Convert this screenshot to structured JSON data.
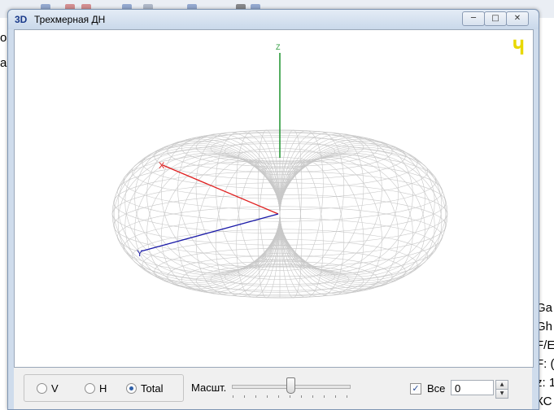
{
  "background_app": {
    "left_glyphs": [
      "о",
      "а"
    ],
    "right_labels": [
      "Ga",
      "Gh",
      "F/E",
      "F: (",
      "z: 1",
      "КС"
    ]
  },
  "window": {
    "icon_text": "3D",
    "title": "Трехмерная ДН",
    "minimize_icon": "minimize-icon",
    "maximize_icon": "maximize-icon",
    "close_icon": "close-icon"
  },
  "viewport": {
    "corner_mark": "Ч",
    "axes": {
      "x_label": "X",
      "y_label": "Y",
      "z_label": "Z"
    },
    "colors": {
      "x_axis": "#e02020",
      "y_axis": "#1a1aa8",
      "z_axis": "#2a9a3a",
      "mesh": "#c8c8c8",
      "corner_mark": "#e8d800"
    }
  },
  "controls": {
    "radio_options": [
      {
        "label": "V",
        "selected": false
      },
      {
        "label": "H",
        "selected": false
      },
      {
        "label": "Total",
        "selected": true
      }
    ],
    "scale_label": "Масшт.",
    "scale_level": 0.5,
    "all_checkbox": {
      "label": "Все",
      "checked": true
    },
    "number_value": "0"
  }
}
